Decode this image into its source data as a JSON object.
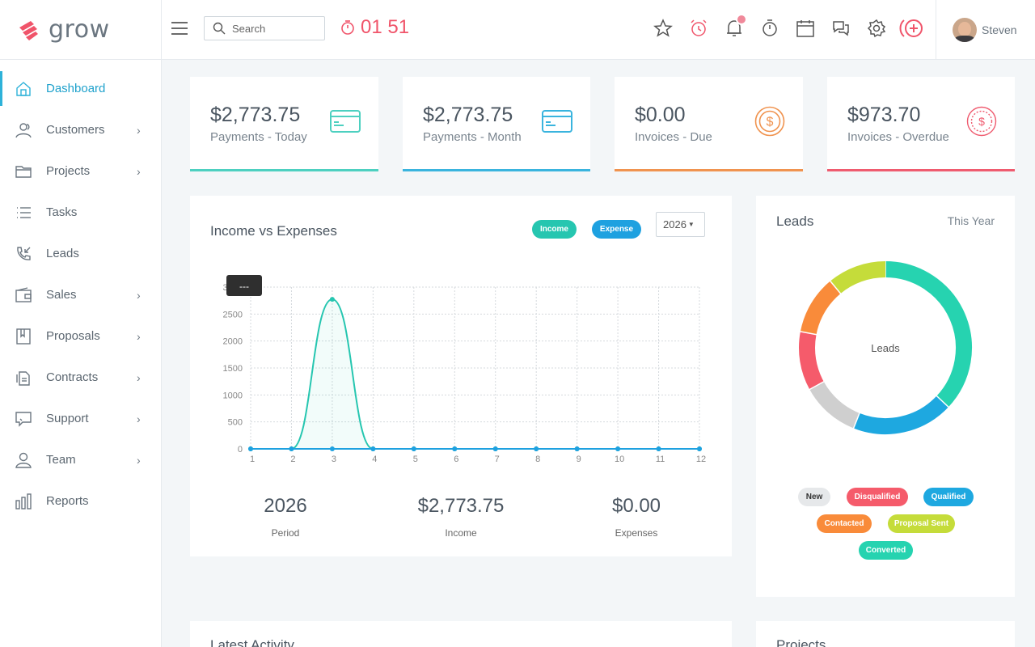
{
  "app": {
    "logo_text": "grow"
  },
  "sidebar": {
    "items": [
      {
        "label": "Dashboard",
        "icon": "home-icon",
        "active": true,
        "has_children": false
      },
      {
        "label": "Customers",
        "icon": "users-icon",
        "has_children": true
      },
      {
        "label": "Projects",
        "icon": "folder-icon",
        "has_children": true
      },
      {
        "label": "Tasks",
        "icon": "list-icon",
        "has_children": false
      },
      {
        "label": "Leads",
        "icon": "phone-incoming-icon",
        "has_children": false
      },
      {
        "label": "Sales",
        "icon": "wallet-icon",
        "has_children": true
      },
      {
        "label": "Proposals",
        "icon": "bookmark-icon",
        "has_children": true
      },
      {
        "label": "Contracts",
        "icon": "documents-icon",
        "has_children": true
      },
      {
        "label": "Support",
        "icon": "chat-support-icon",
        "has_children": true
      },
      {
        "label": "Team",
        "icon": "user-icon",
        "has_children": true
      },
      {
        "label": "Reports",
        "icon": "bar-chart-icon",
        "has_children": false
      }
    ]
  },
  "topbar": {
    "search_placeholder": "Search",
    "timer": "01 51",
    "icons": [
      "star-icon",
      "alarm-icon",
      "bell-icon",
      "stopwatch-icon",
      "calendar-icon",
      "chat-icon",
      "gear-icon",
      "add-circle-icon"
    ],
    "user_name": "Steven"
  },
  "stats": [
    {
      "value": "$2,773.75",
      "label": "Payments - Today",
      "icon": "credit-card-icon",
      "color": "#4dd0c0"
    },
    {
      "value": "$2,773.75",
      "label": "Payments - Month",
      "icon": "credit-card-icon",
      "color": "#3ab4de"
    },
    {
      "value": "$0.00",
      "label": "Invoices - Due",
      "icon": "dollar-coin-icon",
      "color": "#f0934f"
    },
    {
      "value": "$973.70",
      "label": "Invoices - Overdue",
      "icon": "dollar-coin-icon",
      "color": "#ef5b6f"
    }
  ],
  "income_panel": {
    "title": "Income vs Expenses",
    "legend_income": "Income",
    "legend_expense": "Expense",
    "year": "2026",
    "tooltip": "---",
    "summary": [
      {
        "value": "2026",
        "label": "Period"
      },
      {
        "value": "$2,773.75",
        "label": "Income"
      },
      {
        "value": "$0.00",
        "label": "Expenses"
      }
    ]
  },
  "chart_data": {
    "type": "area",
    "x": [
      1,
      2,
      3,
      4,
      5,
      6,
      7,
      8,
      9,
      10,
      11,
      12
    ],
    "series": [
      {
        "name": "Income",
        "values": [
          0,
          0,
          2773.75,
          0,
          0,
          0,
          0,
          0,
          0,
          0,
          0,
          0
        ],
        "color": "#26c6b0"
      },
      {
        "name": "Expense",
        "values": [
          0,
          0,
          0,
          0,
          0,
          0,
          0,
          0,
          0,
          0,
          0,
          0
        ],
        "color": "#1ea1e0"
      }
    ],
    "yticks": [
      "0",
      "500",
      "1000",
      "1500",
      "2000",
      "2500",
      "3000"
    ],
    "ylim": [
      0,
      3000
    ],
    "grid": true
  },
  "leads_panel": {
    "title": "Leads",
    "period": "This Year",
    "center_label": "Leads",
    "segments": [
      {
        "name": "Converted",
        "value": 37,
        "color": "#26d3b0"
      },
      {
        "name": "Qualified",
        "value": 19,
        "color": "#1ea8e0"
      },
      {
        "name": "New",
        "value": 11,
        "color": "#cfcfcf"
      },
      {
        "name": "Disqualified",
        "value": 11,
        "color": "#f55b6b"
      },
      {
        "name": "Contacted",
        "value": 11,
        "color": "#f98b3a"
      },
      {
        "name": "Proposal Sent",
        "value": 11,
        "color": "#c5dc3a"
      }
    ],
    "legend": [
      {
        "name": "New",
        "color": "#e6e8ea",
        "text": "#333333"
      },
      {
        "name": "Disqualified",
        "color": "#f55b6b",
        "text": "#ffffff"
      },
      {
        "name": "Qualified",
        "color": "#1ea8e0",
        "text": "#ffffff"
      },
      {
        "name": "Contacted",
        "color": "#f98b3a",
        "text": "#ffffff"
      },
      {
        "name": "Proposal Sent",
        "color": "#c5dc3a",
        "text": "#ffffff"
      },
      {
        "name": "Converted",
        "color": "#26d3b0",
        "text": "#ffffff"
      }
    ]
  },
  "bottom_panels": {
    "latest_activity": "Latest Activity",
    "projects": "Projects"
  }
}
